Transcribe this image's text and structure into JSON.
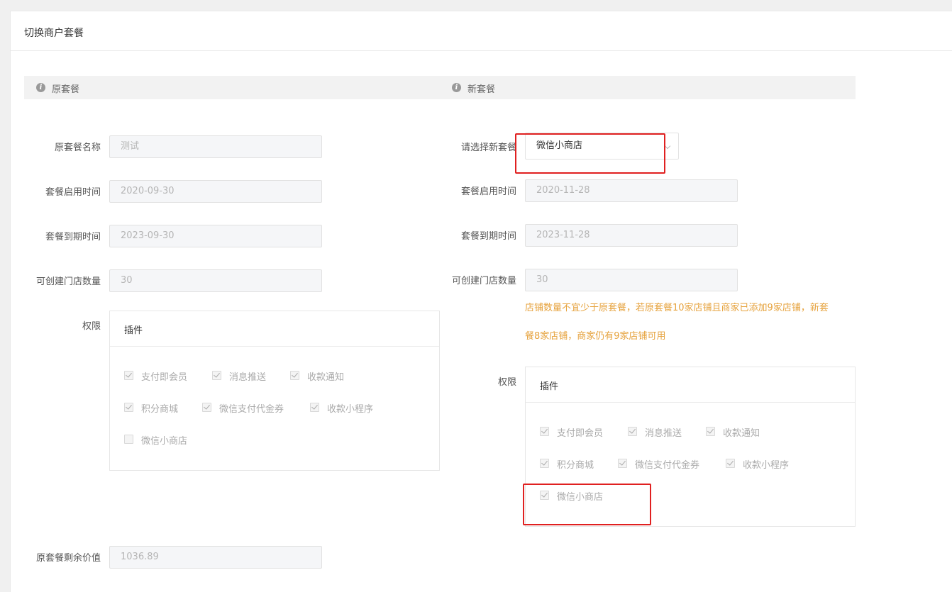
{
  "page_title": "切换商户套餐",
  "old": {
    "section_title": "原套餐",
    "name_label": "原套餐名称",
    "name_value": "测试",
    "start_label": "套餐启用时间",
    "start_value": "2020-09-30",
    "end_label": "套餐到期时间",
    "end_value": "2023-09-30",
    "stores_label": "可创建门店数量",
    "stores_value": "30",
    "perm_label": "权限",
    "plugin_title": "插件",
    "plugins": [
      {
        "label": "支付即会员",
        "checked": true
      },
      {
        "label": "消息推送",
        "checked": true
      },
      {
        "label": "收款通知",
        "checked": true
      },
      {
        "label": "积分商城",
        "checked": true
      },
      {
        "label": "微信支付代金券",
        "checked": true
      },
      {
        "label": "收款小程序",
        "checked": true
      },
      {
        "label": "微信小商店",
        "checked": false
      }
    ],
    "remaining_label": "原套餐剩余价值",
    "remaining_value": "1036.89"
  },
  "new": {
    "section_title": "新套餐",
    "select_label": "请选择新套餐",
    "select_value": "微信小商店",
    "start_label": "套餐启用时间",
    "start_value": "2020-11-28",
    "end_label": "套餐到期时间",
    "end_value": "2023-11-28",
    "stores_label": "可创建门店数量",
    "stores_value": "30",
    "stores_hint_line1": "店铺数量不宜少于原套餐，若原套餐10家店铺且商家已添加9家店铺，新套",
    "stores_hint_line2": "餐8家店铺，商家仍有9家店铺可用",
    "perm_label": "权限",
    "plugin_title": "插件",
    "plugins": [
      {
        "label": "支付即会员",
        "checked": true
      },
      {
        "label": "消息推送",
        "checked": true
      },
      {
        "label": "收款通知",
        "checked": true
      },
      {
        "label": "积分商城",
        "checked": true
      },
      {
        "label": "微信支付代金券",
        "checked": true
      },
      {
        "label": "收款小程序",
        "checked": true
      },
      {
        "label": "微信小商店",
        "checked": true
      }
    ]
  },
  "colors": {
    "highlight": "#e02020",
    "hint": "#e6a23c"
  }
}
